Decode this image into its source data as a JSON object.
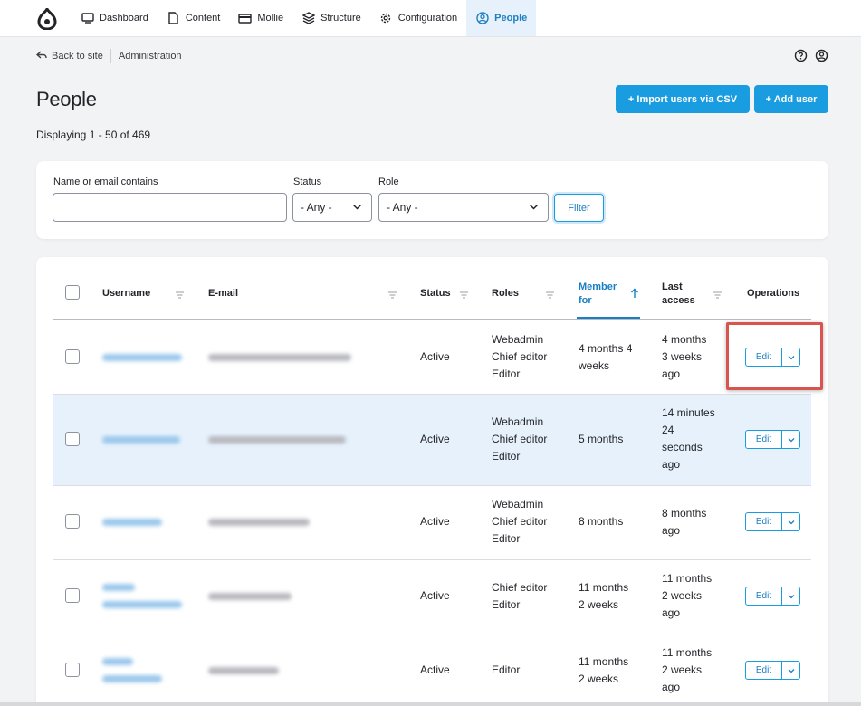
{
  "toolbar": {
    "items": [
      {
        "label": "Dashboard",
        "icon": "monitor-icon"
      },
      {
        "label": "Content",
        "icon": "document-icon"
      },
      {
        "label": "Mollie",
        "icon": "credit-card-icon"
      },
      {
        "label": "Structure",
        "icon": "layers-icon"
      },
      {
        "label": "Configuration",
        "icon": "gear-icon"
      },
      {
        "label": "People",
        "icon": "user-circle-icon",
        "active": true
      }
    ]
  },
  "secondary": {
    "back_label": "Back to site",
    "admin_label": "Administration"
  },
  "page": {
    "title": "People",
    "count": "Displaying 1 - 50 of 469",
    "import_label": "+ Import users via CSV",
    "add_label": "+ Add user"
  },
  "filters": {
    "name_label": "Name or email contains",
    "name_value": "",
    "status_label": "Status",
    "status_value": "- Any -",
    "role_label": "Role",
    "role_value": "- Any -",
    "filter_label": "Filter"
  },
  "table": {
    "headers": {
      "username": "Username",
      "email": "E-mail",
      "status": "Status",
      "roles": "Roles",
      "member_for_1": "Member",
      "member_for_2": "for",
      "last_access_1": "Last",
      "last_access_2": "access",
      "operations": "Operations"
    },
    "rows": [
      {
        "status": "Active",
        "roles": [
          "Webadmin",
          "Chief editor",
          "Editor"
        ],
        "member_for": [
          "4 months 4",
          "weeks"
        ],
        "last_access": [
          "4 months",
          "3 weeks",
          "ago"
        ],
        "edit": "Edit"
      },
      {
        "status": "Active",
        "roles": [
          "Webadmin",
          "Chief editor",
          "Editor"
        ],
        "member_for": [
          "5 months"
        ],
        "last_access": [
          "14 minutes",
          "24",
          "seconds",
          "ago"
        ],
        "edit": "Edit"
      },
      {
        "status": "Active",
        "roles": [
          "Webadmin",
          "Chief editor",
          "Editor"
        ],
        "member_for": [
          "8 months"
        ],
        "last_access": [
          "8 months",
          "ago"
        ],
        "edit": "Edit"
      },
      {
        "status": "Active",
        "roles": [
          "Chief editor",
          "Editor"
        ],
        "member_for": [
          "11 months",
          "2 weeks"
        ],
        "last_access": [
          "11 months",
          "2 weeks",
          "ago"
        ],
        "edit": "Edit"
      },
      {
        "status": "Active",
        "roles": [
          "Editor"
        ],
        "member_for": [
          "11 months",
          "2 weeks"
        ],
        "last_access": [
          "11 months",
          "2 weeks",
          "ago"
        ],
        "edit": "Edit"
      }
    ]
  },
  "colors": {
    "accent": "#1a9ce0",
    "active_tab_bg": "#e6f1fb",
    "highlight": "#d9534f"
  }
}
